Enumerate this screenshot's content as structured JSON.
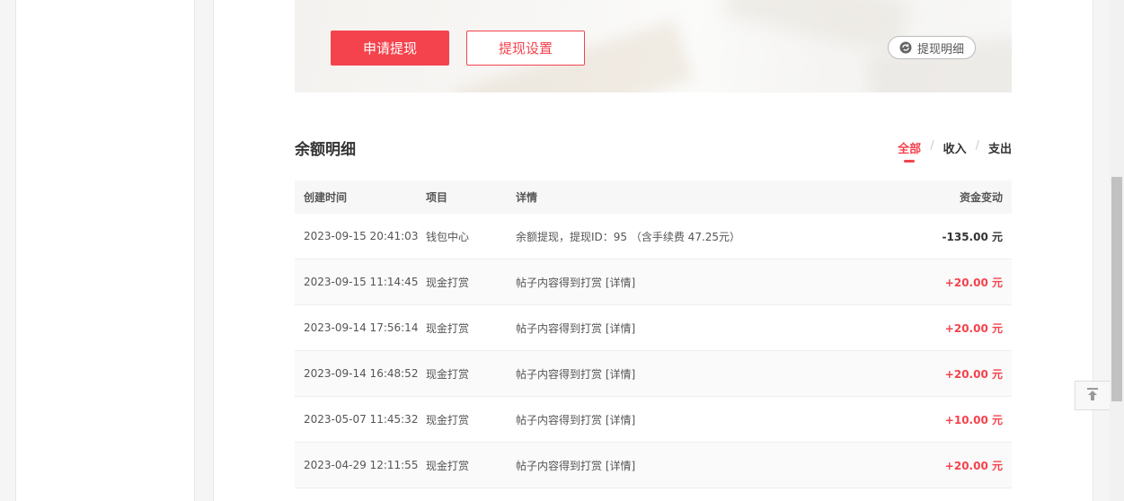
{
  "actions": {
    "withdraw_label": "申请提现",
    "settings_label": "提现设置",
    "detail_label": "提现明细"
  },
  "balance": {
    "title": "余额明细",
    "tabs": [
      "全部",
      "收入",
      "支出"
    ],
    "active_tab": "全部",
    "columns": [
      "创建时间",
      "项目",
      "详情",
      "资金变动"
    ],
    "rows": [
      {
        "time": "2023-09-15 20:41:03",
        "item": "钱包中心",
        "detail": "余额提现，提现ID：95 （含手续费 47.25元）",
        "amount": "-135.00 元"
      },
      {
        "time": "2023-09-15 11:14:45",
        "item": "现金打赏",
        "detail": "帖子内容得到打赏 [详情]",
        "amount": "+20.00 元"
      },
      {
        "time": "2023-09-14 17:56:14",
        "item": "现金打赏",
        "detail": "帖子内容得到打赏 [详情]",
        "amount": "+20.00 元"
      },
      {
        "time": "2023-09-14 16:48:52",
        "item": "现金打赏",
        "detail": "帖子内容得到打赏 [详情]",
        "amount": "+20.00 元"
      },
      {
        "time": "2023-05-07 11:45:32",
        "item": "现金打赏",
        "detail": "帖子内容得到打赏 [详情]",
        "amount": "+10.00 元"
      },
      {
        "time": "2023-04-29 12:11:55",
        "item": "现金打赏",
        "detail": "帖子内容得到打赏 [详情]",
        "amount": "+20.00 元"
      }
    ]
  },
  "colors": {
    "accent": "#f4434d",
    "negative_amount": "#333333"
  },
  "icons": {
    "detail": "refresh-icon",
    "back_to_top": "arrow-up-icon"
  }
}
